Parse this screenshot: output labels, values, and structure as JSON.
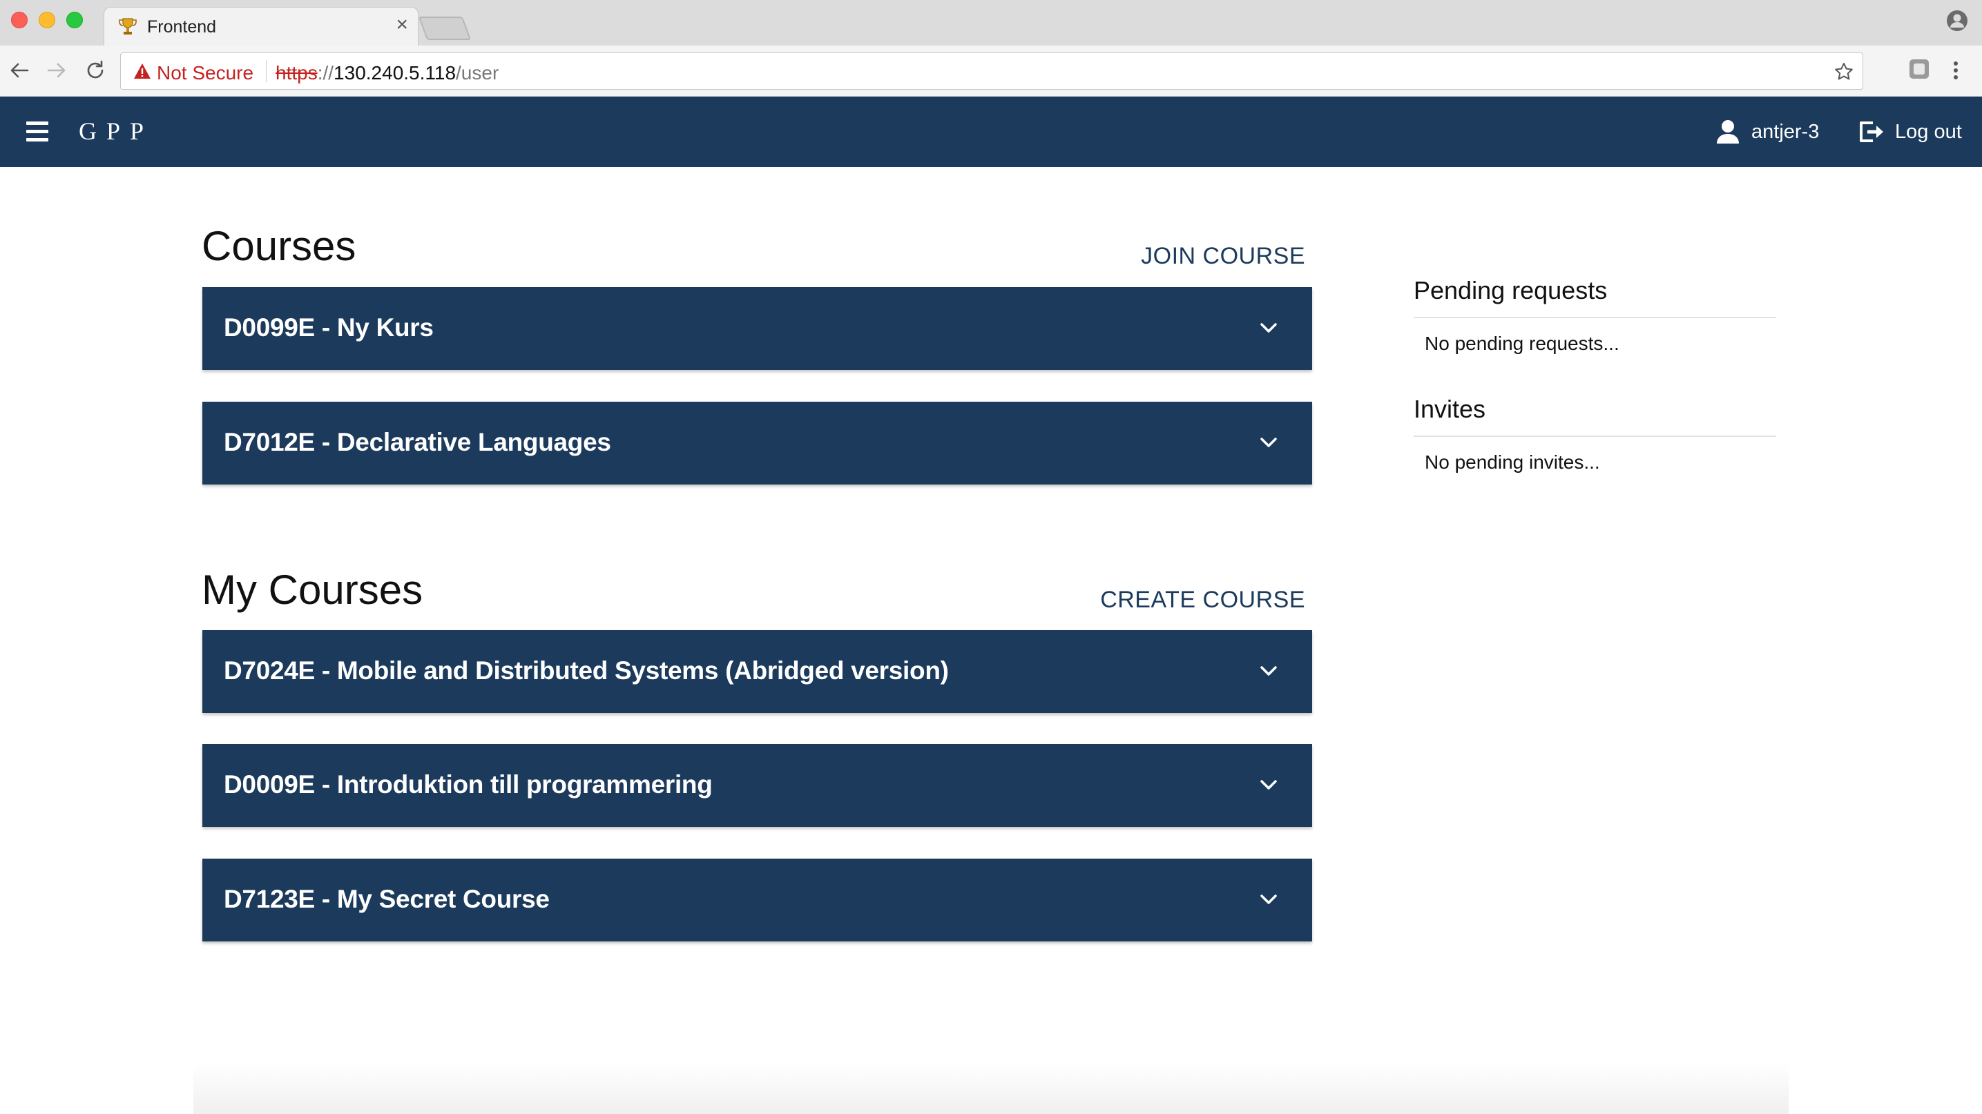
{
  "browser": {
    "tab_title": "Frontend",
    "tab_close": "×",
    "security_label": "Not Secure",
    "url_scheme": "https",
    "url_separator": "://",
    "url_host": "130.240.5.118",
    "url_path": "/user"
  },
  "navbar": {
    "brand": "GPP",
    "username": "antjer-3",
    "logout_label": "Log out"
  },
  "courses": {
    "title": "Courses",
    "action": "JOIN COURSE",
    "items": [
      {
        "label": "D0099E - Ny Kurs"
      },
      {
        "label": "D7012E - Declarative Languages"
      }
    ]
  },
  "my_courses": {
    "title": "My Courses",
    "action": "CREATE COURSE",
    "items": [
      {
        "label": "D7024E - Mobile and Distributed Systems (Abridged version)"
      },
      {
        "label": "D0009E - Introduktion till programmering"
      },
      {
        "label": "D7123E - My Secret Course"
      }
    ]
  },
  "sidebar": {
    "pending_title": "Pending requests",
    "pending_text": "No pending requests...",
    "invites_title": "Invites",
    "invites_text": "No pending invites..."
  },
  "colors": {
    "primary": "#1b3a5c",
    "not_secure": "#c5221f"
  }
}
